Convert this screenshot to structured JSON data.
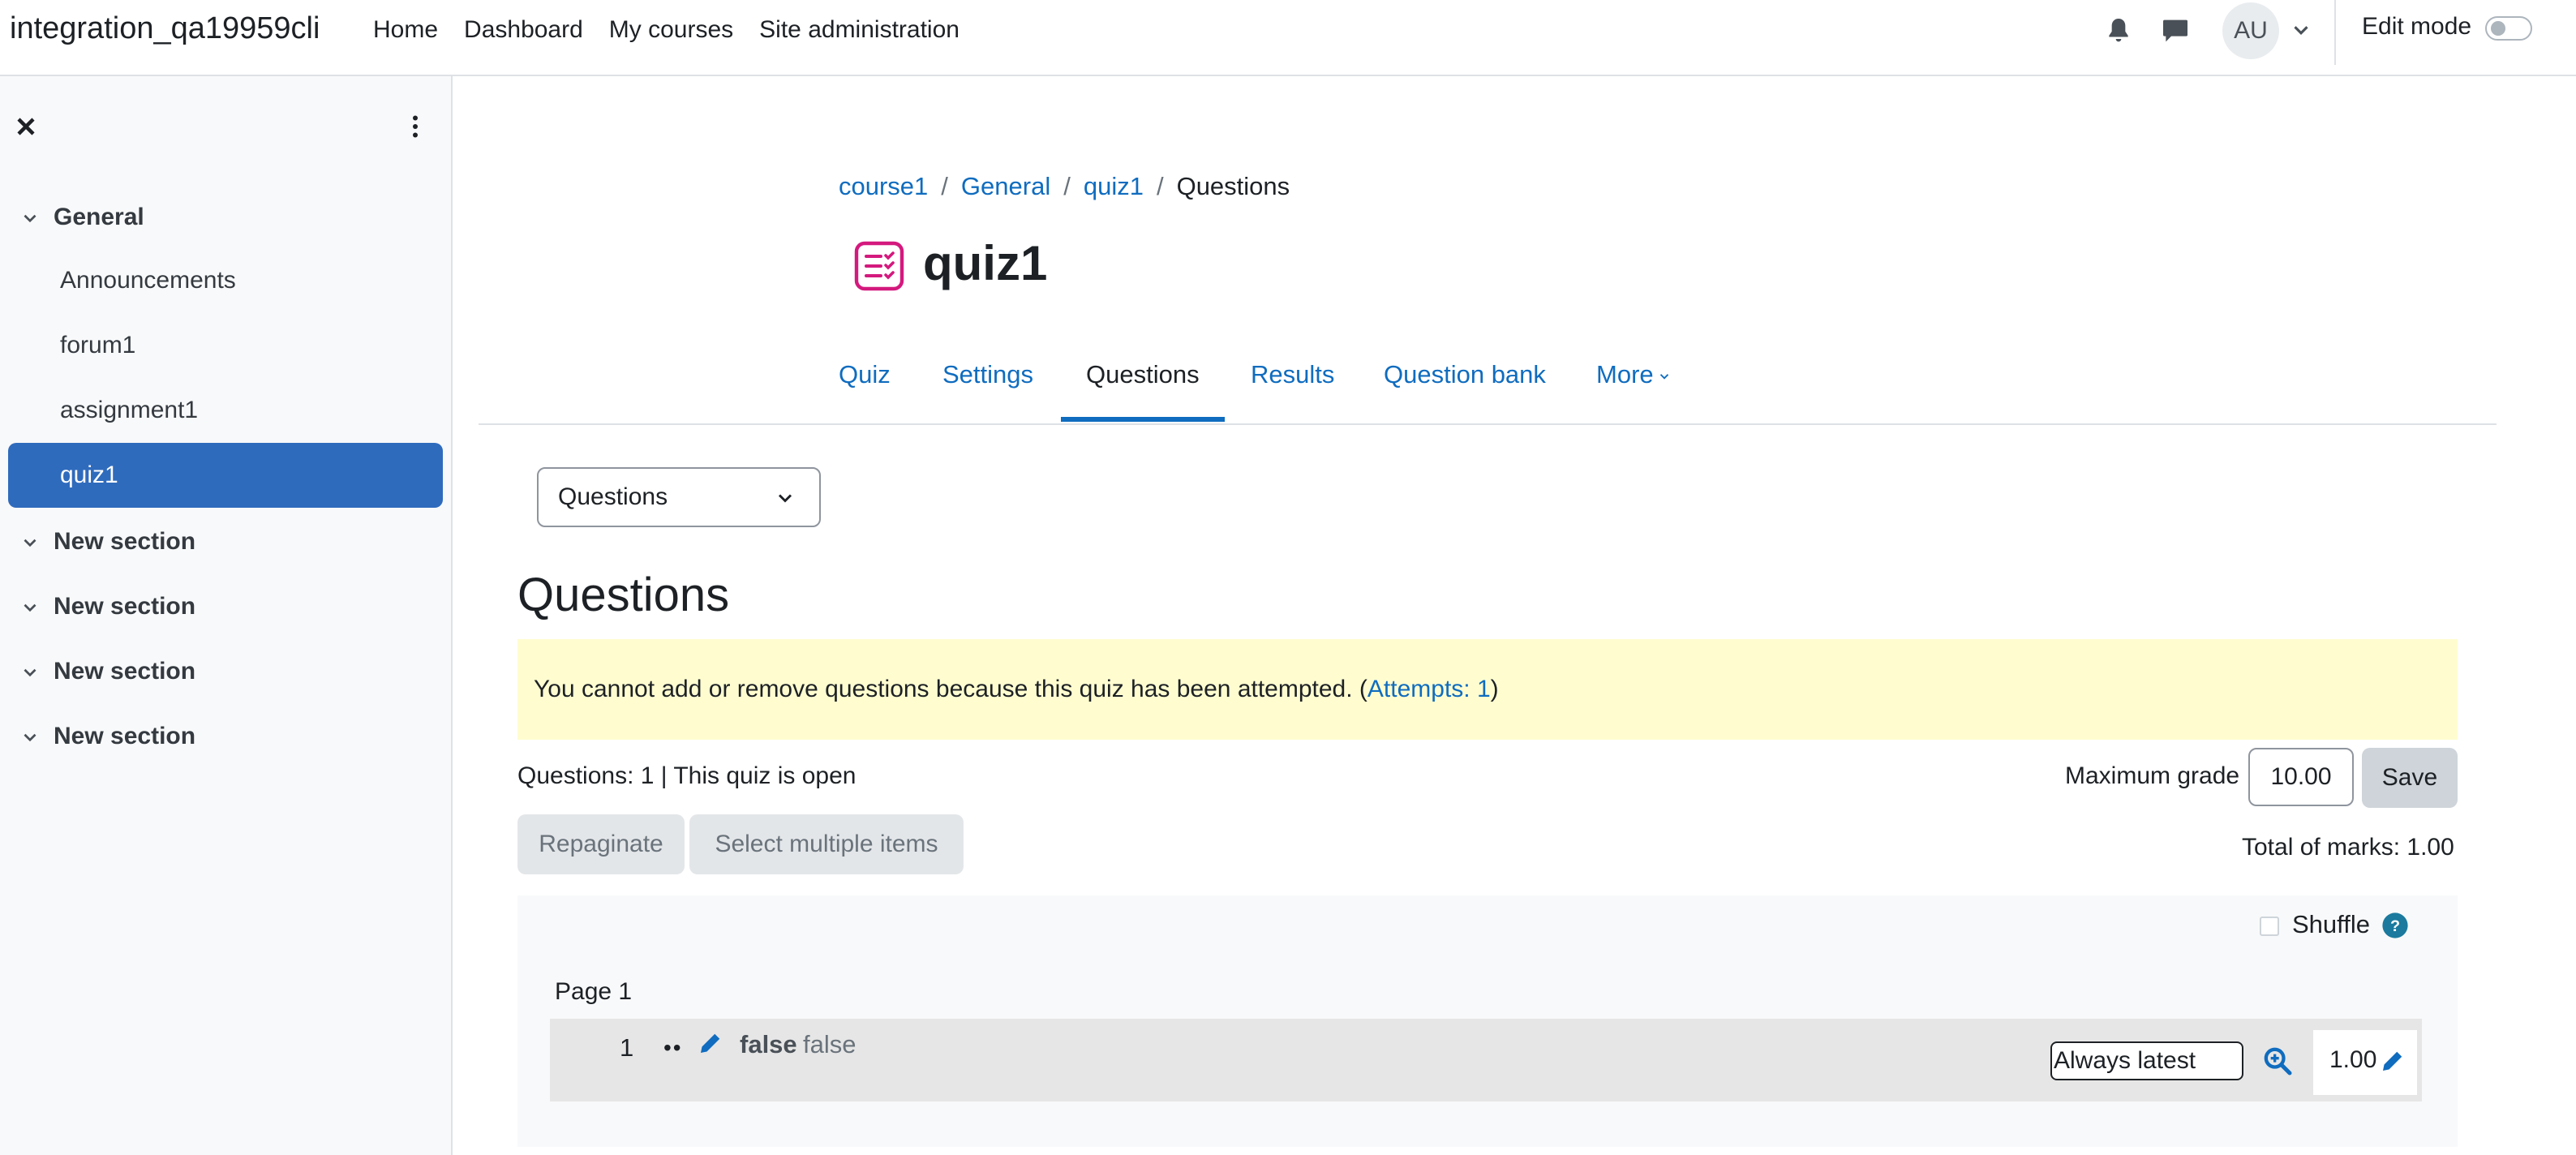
{
  "navbar": {
    "site_name": "integration_qa19959cli",
    "links": [
      "Home",
      "Dashboard",
      "My courses",
      "Site administration"
    ],
    "avatar_initials": "AU",
    "edit_mode_label": "Edit mode",
    "edit_mode_on": false,
    "icons": [
      "bell-icon",
      "chat-icon",
      "chevron-down-icon"
    ]
  },
  "drawer": {
    "sections": [
      {
        "title": "General",
        "expanded": true,
        "activities": [
          "Announcements",
          "forum1",
          "assignment1",
          "quiz1"
        ]
      },
      {
        "title": "New section"
      },
      {
        "title": "New section"
      },
      {
        "title": "New section"
      },
      {
        "title": "New section"
      }
    ],
    "active_activity": "quiz1"
  },
  "breadcrumb": {
    "items": [
      "course1",
      "General",
      "quiz1"
    ],
    "separator": "/",
    "current": "Questions"
  },
  "page": {
    "title": "quiz1",
    "tabs": [
      "Quiz",
      "Settings",
      "Questions",
      "Results",
      "Question bank",
      "More"
    ],
    "active_tab": "Questions"
  },
  "main": {
    "selector_value": "Questions",
    "heading": "Questions",
    "alert_text": "You cannot add or remove questions because this quiz has been attempted. (",
    "alert_link": "Attempts: 1",
    "alert_close": ")",
    "status_line": "Questions: 1 | This quiz is open",
    "max_grade_label": "Maximum grade",
    "max_grade_value": "10.00",
    "save_label": "Save",
    "repaginate_label": "Repaginate",
    "select_multiple_label": "Select multiple items",
    "total_marks": "Total of marks: 1.00",
    "shuffle_label": "Shuffle",
    "shuffle_checked": false,
    "page_label": "Page 1",
    "slot": {
      "number": "1",
      "dots": "••",
      "name": "false",
      "text": "false",
      "version": "Always latest",
      "mark": "1.00"
    }
  },
  "colors": {
    "link": "#0f6cbf",
    "active_item_bg": "#2f6bbd",
    "alert_bg": "#fffdd0",
    "quiz_icon": "#d4197e"
  }
}
